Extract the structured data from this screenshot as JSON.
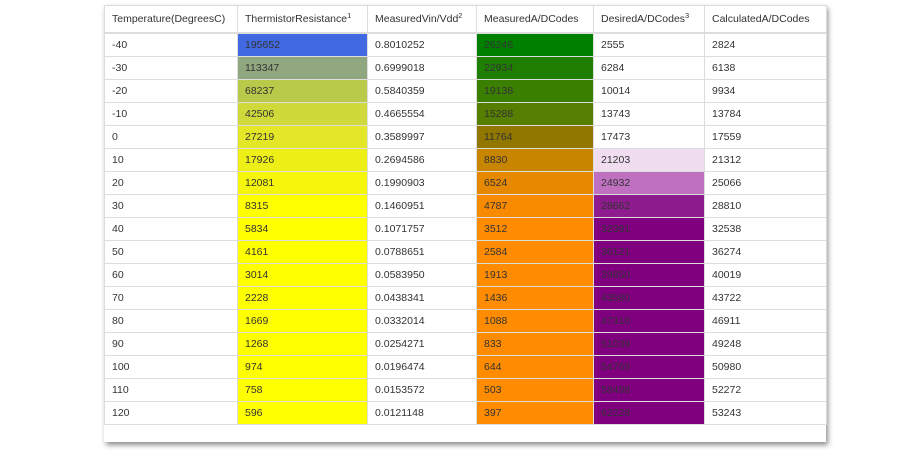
{
  "table": {
    "headers": [
      {
        "label": "Temperature(DegreesC)",
        "sup": ""
      },
      {
        "label": "ThermistorResistance",
        "sup": "1"
      },
      {
        "label": "MeasuredVin/Vdd",
        "sup": "2"
      },
      {
        "label": "MeasuredA/DCodes",
        "sup": ""
      },
      {
        "label": "DesiredA/DCodes",
        "sup": "3"
      },
      {
        "label": "CalculatedA/DCodes",
        "sup": ""
      }
    ],
    "rows": [
      {
        "temp": "-40",
        "resistance": "195652",
        "vin": "0.8010252",
        "measured": "26246",
        "desired": "2555",
        "calculated": "2824"
      },
      {
        "temp": "-30",
        "resistance": "113347",
        "vin": "0.6999018",
        "measured": "22934",
        "desired": "6284",
        "calculated": "6138"
      },
      {
        "temp": "-20",
        "resistance": "68237",
        "vin": "0.5840359",
        "measured": "19138",
        "desired": "10014",
        "calculated": "9934"
      },
      {
        "temp": "-10",
        "resistance": "42506",
        "vin": "0.4665554",
        "measured": "15288",
        "desired": "13743",
        "calculated": "13784"
      },
      {
        "temp": "0",
        "resistance": "27219",
        "vin": "0.3589997",
        "measured": "11764",
        "desired": "17473",
        "calculated": "17559"
      },
      {
        "temp": "10",
        "resistance": "17926",
        "vin": "0.2694586",
        "measured": "8830",
        "desired": "21203",
        "calculated": "21312"
      },
      {
        "temp": "20",
        "resistance": "12081",
        "vin": "0.1990903",
        "measured": "6524",
        "desired": "24932",
        "calculated": "25066"
      },
      {
        "temp": "30",
        "resistance": "8315",
        "vin": "0.1460951",
        "measured": "4787",
        "desired": "28662",
        "calculated": "28810"
      },
      {
        "temp": "40",
        "resistance": "5834",
        "vin": "0.1071757",
        "measured": "3512",
        "desired": "32391",
        "calculated": "32538"
      },
      {
        "temp": "50",
        "resistance": "4161",
        "vin": "0.0788651",
        "measured": "2584",
        "desired": "36121",
        "calculated": "36274"
      },
      {
        "temp": "60",
        "resistance": "3014",
        "vin": "0.0583950",
        "measured": "1913",
        "desired": "39850",
        "calculated": "40019"
      },
      {
        "temp": "70",
        "resistance": "2228",
        "vin": "0.0438341",
        "measured": "1436",
        "desired": "43580",
        "calculated": "43722"
      },
      {
        "temp": "80",
        "resistance": "1669",
        "vin": "0.0332014",
        "measured": "1088",
        "desired": "47310",
        "calculated": "46911"
      },
      {
        "temp": "90",
        "resistance": "1268",
        "vin": "0.0254271",
        "measured": "833",
        "desired": "51039",
        "calculated": "49248"
      },
      {
        "temp": "100",
        "resistance": "974",
        "vin": "0.0196474",
        "measured": "644",
        "desired": "54769",
        "calculated": "50980"
      },
      {
        "temp": "110",
        "resistance": "758",
        "vin": "0.0153572",
        "measured": "503",
        "desired": "58498",
        "calculated": "52272"
      },
      {
        "temp": "120",
        "resistance": "596",
        "vin": "0.0121148",
        "measured": "397",
        "desired": "62228",
        "calculated": "53243"
      }
    ],
    "colors": {
      "resistance": [
        "#4169e1",
        "#8fa67e",
        "#b9c94a",
        "#cfd93a",
        "#e4e628",
        "#efef18",
        "#f6f60c",
        "#ffff00",
        "#ffff00",
        "#ffff00",
        "#ffff00",
        "#ffff00",
        "#ffff00",
        "#ffff00",
        "#ffff00",
        "#ffff00",
        "#ffff00"
      ],
      "measured": [
        "#008000",
        "#1e7f00",
        "#3a7f00",
        "#567e00",
        "#917700",
        "#c88500",
        "#e68800",
        "#f88a00",
        "#ff8c00",
        "#ff8c00",
        "#ff8c00",
        "#ff8c00",
        "#ff8c00",
        "#ff8c00",
        "#ff8c00",
        "#ff8c00",
        "#ff8c00"
      ],
      "desired": [
        "#ffffff",
        "#ffffff",
        "#ffffff",
        "#ffffff",
        "#ffffff",
        "#f0def0",
        "#c070c0",
        "#8e1c8e",
        "#800080",
        "#800080",
        "#800080",
        "#800080",
        "#800080",
        "#800080",
        "#800080",
        "#800080",
        "#800080"
      ]
    }
  }
}
